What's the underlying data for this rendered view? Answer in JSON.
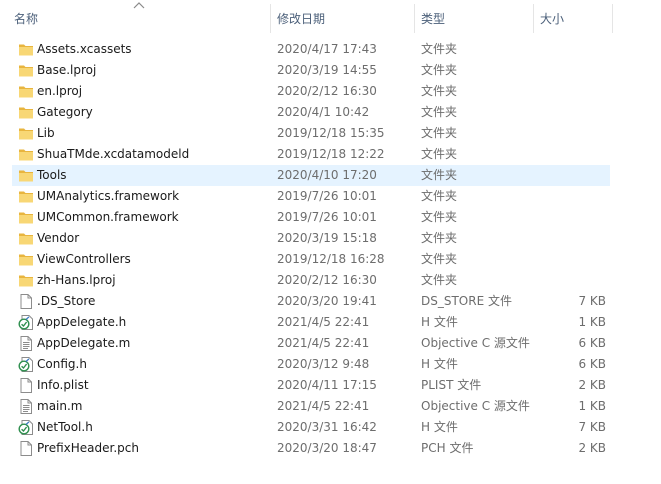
{
  "header": {
    "col_name": "名称",
    "col_date": "修改日期",
    "col_type": "类型",
    "col_size": "大小"
  },
  "rows": [
    {
      "name": "Assets.xcassets",
      "date": "2020/4/17 17:43",
      "type": "文件夹",
      "size": "",
      "icon": "folder-icon"
    },
    {
      "name": "Base.lproj",
      "date": "2020/3/19 14:55",
      "type": "文件夹",
      "size": "",
      "icon": "folder-icon"
    },
    {
      "name": "en.lproj",
      "date": "2020/2/12 16:30",
      "type": "文件夹",
      "size": "",
      "icon": "folder-icon"
    },
    {
      "name": "Gategory",
      "date": "2020/4/1 10:42",
      "type": "文件夹",
      "size": "",
      "icon": "folder-icon"
    },
    {
      "name": "Lib",
      "date": "2019/12/18 15:35",
      "type": "文件夹",
      "size": "",
      "icon": "folder-icon"
    },
    {
      "name": "ShuaTMde.xcdatamodeld",
      "date": "2019/12/18 12:22",
      "type": "文件夹",
      "size": "",
      "icon": "folder-icon"
    },
    {
      "name": "Tools",
      "date": "2020/4/10 17:20",
      "type": "文件夹",
      "size": "",
      "icon": "folder-icon",
      "selected": true
    },
    {
      "name": "UMAnalytics.framework",
      "date": "2019/7/26 10:01",
      "type": "文件夹",
      "size": "",
      "icon": "folder-icon"
    },
    {
      "name": "UMCommon.framework",
      "date": "2019/7/26 10:01",
      "type": "文件夹",
      "size": "",
      "icon": "folder-icon"
    },
    {
      "name": "Vendor",
      "date": "2020/3/19 15:18",
      "type": "文件夹",
      "size": "",
      "icon": "folder-icon"
    },
    {
      "name": "ViewControllers",
      "date": "2019/12/18 16:28",
      "type": "文件夹",
      "size": "",
      "icon": "folder-icon"
    },
    {
      "name": "zh-Hans.lproj",
      "date": "2020/2/12 16:30",
      "type": "文件夹",
      "size": "",
      "icon": "folder-icon"
    },
    {
      "name": ".DS_Store",
      "date": "2020/3/20 19:41",
      "type": "DS_STORE 文件",
      "size": "7 KB",
      "icon": "blank-file-icon"
    },
    {
      "name": "AppDelegate.h",
      "date": "2021/4/5 22:41",
      "type": "H 文件",
      "size": "1 KB",
      "icon": "header-file-icon"
    },
    {
      "name": "AppDelegate.m",
      "date": "2021/4/5 22:41",
      "type": "Objective C 源文件",
      "size": "6 KB",
      "icon": "text-file-icon"
    },
    {
      "name": "Config.h",
      "date": "2020/3/12 9:48",
      "type": "H 文件",
      "size": "6 KB",
      "icon": "header-file-icon"
    },
    {
      "name": "Info.plist",
      "date": "2020/4/11 17:15",
      "type": "PLIST 文件",
      "size": "2 KB",
      "icon": "blank-file-icon"
    },
    {
      "name": "main.m",
      "date": "2021/4/5 22:41",
      "type": "Objective C 源文件",
      "size": "1 KB",
      "icon": "text-file-icon"
    },
    {
      "name": "NetTool.h",
      "date": "2020/3/31 16:42",
      "type": "H 文件",
      "size": "7 KB",
      "icon": "header-file-icon"
    },
    {
      "name": "PrefixHeader.pch",
      "date": "2020/3/20 18:47",
      "type": "PCH 文件",
      "size": "2 KB",
      "icon": "blank-file-icon"
    }
  ],
  "colors": {
    "header_text": "#4c607a",
    "selected_row": "#e5f3ff",
    "folder": "#f8d775",
    "meta_text": "#6d6d6d"
  }
}
